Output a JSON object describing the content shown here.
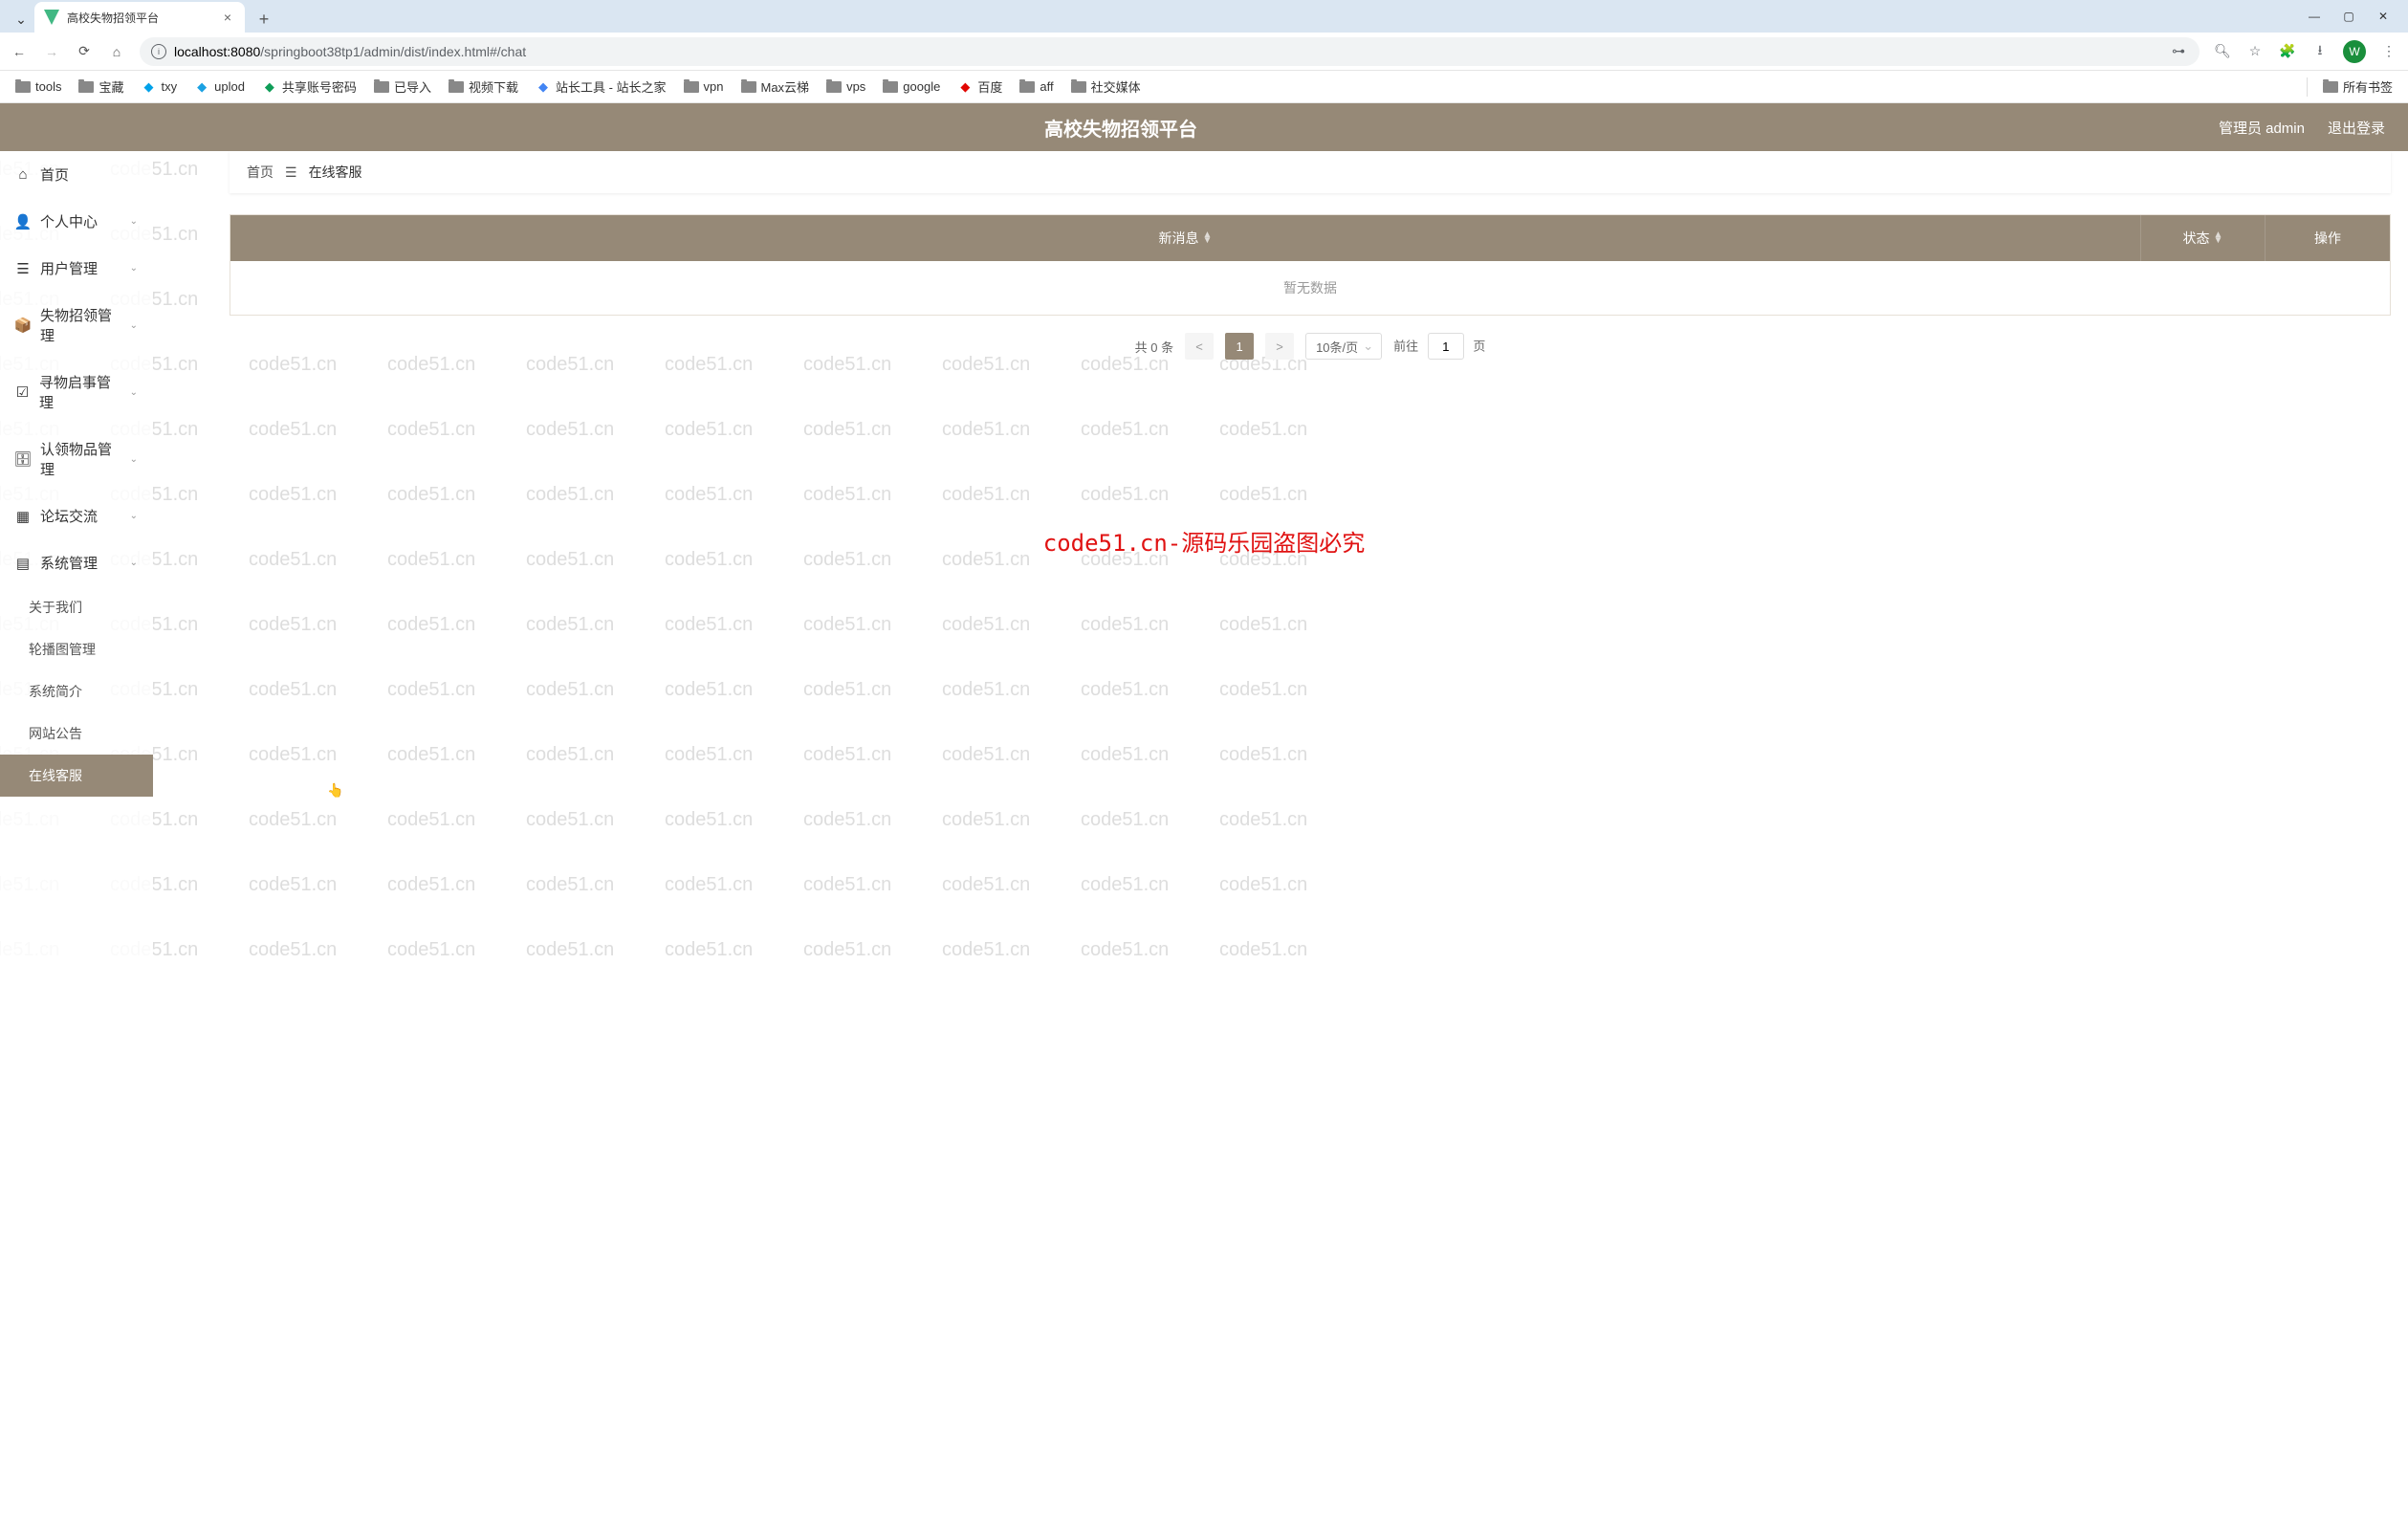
{
  "browser": {
    "tab_title": "高校失物招领平台",
    "url_host": "localhost:8080",
    "url_path": "/springboot38tp1/admin/dist/index.html#/chat",
    "avatar_letter": "W",
    "all_bookmarks": "所有书签"
  },
  "bookmarks": [
    {
      "type": "folder",
      "label": "tools"
    },
    {
      "type": "folder",
      "label": "宝藏"
    },
    {
      "type": "icon",
      "label": "txy",
      "color": "#00a1e9"
    },
    {
      "type": "icon",
      "label": "uplod",
      "color": "#1ba1e2"
    },
    {
      "type": "icon",
      "label": "共享账号密码",
      "color": "#0f9d58"
    },
    {
      "type": "folder",
      "label": "已导入"
    },
    {
      "type": "folder",
      "label": "视频下载"
    },
    {
      "type": "icon",
      "label": "站长工具 - 站长之家",
      "color": "#4285f4"
    },
    {
      "type": "folder",
      "label": "vpn"
    },
    {
      "type": "folder",
      "label": "Max云梯"
    },
    {
      "type": "folder",
      "label": "vps"
    },
    {
      "type": "folder",
      "label": "google"
    },
    {
      "type": "icon",
      "label": "百度",
      "color": "#e10602"
    },
    {
      "type": "folder",
      "label": "aff"
    },
    {
      "type": "folder",
      "label": "社交媒体"
    }
  ],
  "app": {
    "title": "高校失物招领平台",
    "user_label": "管理员 admin",
    "logout_label": "退出登录"
  },
  "sidebar": {
    "items": [
      {
        "icon": "home",
        "label": "首页",
        "expandable": false
      },
      {
        "icon": "user",
        "label": "个人中心",
        "expandable": true
      },
      {
        "icon": "list",
        "label": "用户管理",
        "expandable": true
      },
      {
        "icon": "box",
        "label": "失物招领管理",
        "expandable": true
      },
      {
        "icon": "check",
        "label": "寻物启事管理",
        "expandable": true
      },
      {
        "icon": "archive",
        "label": "认领物品管理",
        "expandable": true
      },
      {
        "icon": "grid",
        "label": "论坛交流",
        "expandable": true
      },
      {
        "icon": "file",
        "label": "系统管理",
        "expandable": true
      }
    ],
    "submenu": [
      {
        "label": "关于我们",
        "active": false
      },
      {
        "label": "轮播图管理",
        "active": false
      },
      {
        "label": "系统简介",
        "active": false
      },
      {
        "label": "网站公告",
        "active": false
      },
      {
        "label": "在线客服",
        "active": true
      }
    ]
  },
  "breadcrumb": {
    "home": "首页",
    "current": "在线客服"
  },
  "table": {
    "columns": {
      "msg": "新消息",
      "status": "状态",
      "action": "操作"
    },
    "empty_text": "暂无数据"
  },
  "pagination": {
    "total_prefix": "共",
    "total_count": "0",
    "total_suffix": "条",
    "prev": "<",
    "page1": "1",
    "next": ">",
    "page_size": "10条/页",
    "goto_prefix": "前往",
    "goto_value": "1",
    "goto_suffix": "页"
  },
  "watermark_main": "code51.cn-源码乐园盗图必究",
  "watermark_bg": "code51.cn"
}
